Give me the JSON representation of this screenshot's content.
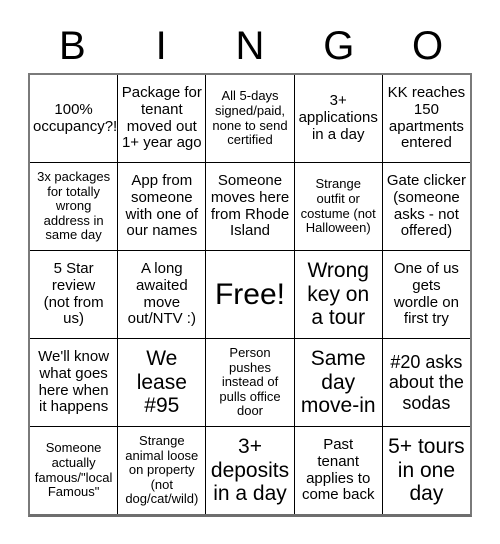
{
  "card": {
    "title": "BINGO",
    "header": {
      "letters": [
        "B",
        "I",
        "N",
        "G",
        "O"
      ]
    },
    "colors": {
      "background": "#ffffff",
      "text": "#000000",
      "inner_grid_line": "#000000",
      "outer_border": "#7a7a7a"
    },
    "grid": {
      "columns": 5,
      "rows": 5,
      "cells": [
        [
          {
            "text": "100%\noccupancy?!",
            "size": "m",
            "free": false
          },
          {
            "text": "Package for\ntenant\nmoved out\n1+ year ago",
            "size": "m",
            "free": false
          },
          {
            "text": "All 5-days\nsigned/paid,\nnone to send\ncertified",
            "size": "s",
            "free": false
          },
          {
            "text": "3+\napplications\nin a day",
            "size": "m",
            "free": false
          },
          {
            "text": "KK reaches\n150\napartments\nentered",
            "size": "m",
            "free": false
          }
        ],
        [
          {
            "text": "3x packages\nfor totally\nwrong\naddress in\nsame day",
            "size": "s",
            "free": false
          },
          {
            "text": "App from\nsomeone\nwith one of\nour names",
            "size": "m",
            "free": false
          },
          {
            "text": "Someone\nmoves here\nfrom Rhode\nIsland",
            "size": "m",
            "free": false
          },
          {
            "text": "Strange\noutfit or\ncostume (not\nHalloween)",
            "size": "s",
            "free": false
          },
          {
            "text": "Gate clicker\n(someone\nasks - not\noffered)",
            "size": "m",
            "free": false
          }
        ],
        [
          {
            "text": "5 Star\nreview\n(not from\nus)",
            "size": "m",
            "free": false
          },
          {
            "text": "A long\nawaited\nmove\nout/NTV :)",
            "size": "m",
            "free": false
          },
          {
            "text": "Free!",
            "size": "free",
            "free": true
          },
          {
            "text": "Wrong\nkey on\na tour",
            "size": "xl",
            "free": false
          },
          {
            "text": "One of us\ngets\nwordle on\nfirst try",
            "size": "m",
            "free": false
          }
        ],
        [
          {
            "text": "We'll know\nwhat goes\nhere when\nit happens",
            "size": "m",
            "free": false
          },
          {
            "text": "We\nlease\n#95",
            "size": "xl",
            "free": false
          },
          {
            "text": "Person\npushes\ninstead of\npulls office\ndoor",
            "size": "s",
            "free": false
          },
          {
            "text": "Same\nday\nmove-in",
            "size": "xl",
            "free": false
          },
          {
            "text": "#20 asks\nabout the\nsodas",
            "size": "l",
            "free": false
          }
        ],
        [
          {
            "text": "Someone\nactually\nfamous/\"local\nFamous\"",
            "size": "s",
            "free": false
          },
          {
            "text": "Strange\nanimal loose\non property\n(not\ndog/cat/wild)",
            "size": "s",
            "free": false
          },
          {
            "text": "3+\ndeposits\nin a day",
            "size": "xl",
            "free": false
          },
          {
            "text": "Past\ntenant\napplies to\ncome back",
            "size": "m",
            "free": false
          },
          {
            "text": "5+ tours\nin one\nday",
            "size": "xl",
            "free": false
          }
        ]
      ]
    }
  }
}
